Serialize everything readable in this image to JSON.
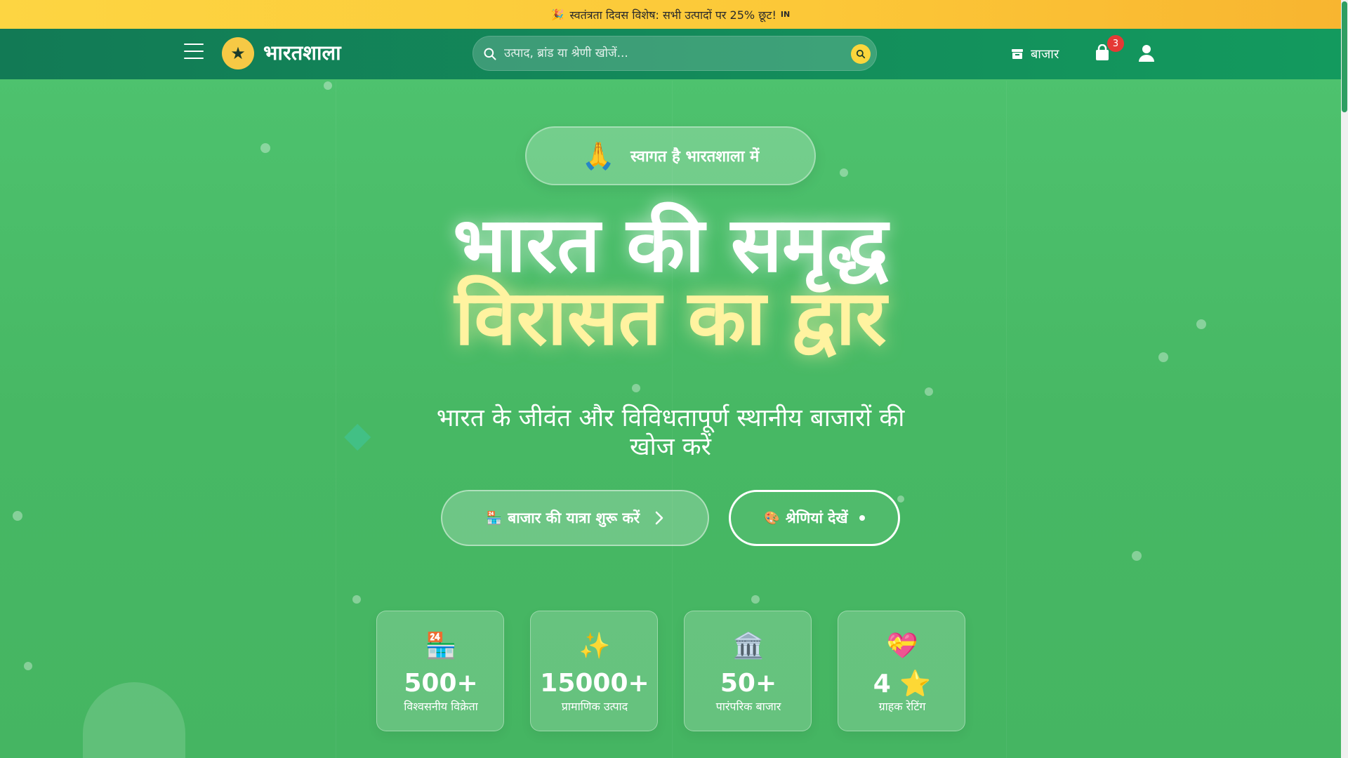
{
  "promo": {
    "emoji": "🎉",
    "text": "स्वतंत्रता दिवस विशेष: सभी उत्पादों पर 25% छूट!",
    "flag": "IN"
  },
  "header": {
    "brand": "भारतशाला",
    "search_placeholder": "उत्पाद, ब्रांड या श्रेणी खोजें...",
    "market_label": "बाजार",
    "cart_count": "3"
  },
  "hero": {
    "welcome_emoji": "🙏",
    "welcome_text": "स्वागत है भारतशाला में",
    "headline_line1": "भारत की समृद्ध",
    "headline_line2": "विरासत का द्वार",
    "subtitle": "भारत के जीवंत और विविधतापूर्ण स्थानीय बाजारों की खोज करें",
    "primary_button": {
      "emoji": "🏪",
      "label": "बाजार की यात्रा शुरू करें"
    },
    "secondary_button": {
      "emoji": "🎨",
      "label": "श्रेणियां देखें"
    }
  },
  "stats": [
    {
      "icon": "🏪",
      "value": "500+",
      "label": "विश्वसनीय विक्रेता"
    },
    {
      "icon": "✨",
      "value": "15000+",
      "label": "प्रामाणिक उत्पाद"
    },
    {
      "icon": "🏛️",
      "value": "50+",
      "label": "पारंपरिक बाजार"
    },
    {
      "icon": "💝",
      "value": "4 ⭐",
      "label": "ग्राहक रेटिंग"
    }
  ],
  "colors": {
    "background": "#4fc470",
    "header": "#138a5a",
    "promo": "#fdd542",
    "accent_yellow": "#fcd63c",
    "badge_red": "#e53935"
  }
}
